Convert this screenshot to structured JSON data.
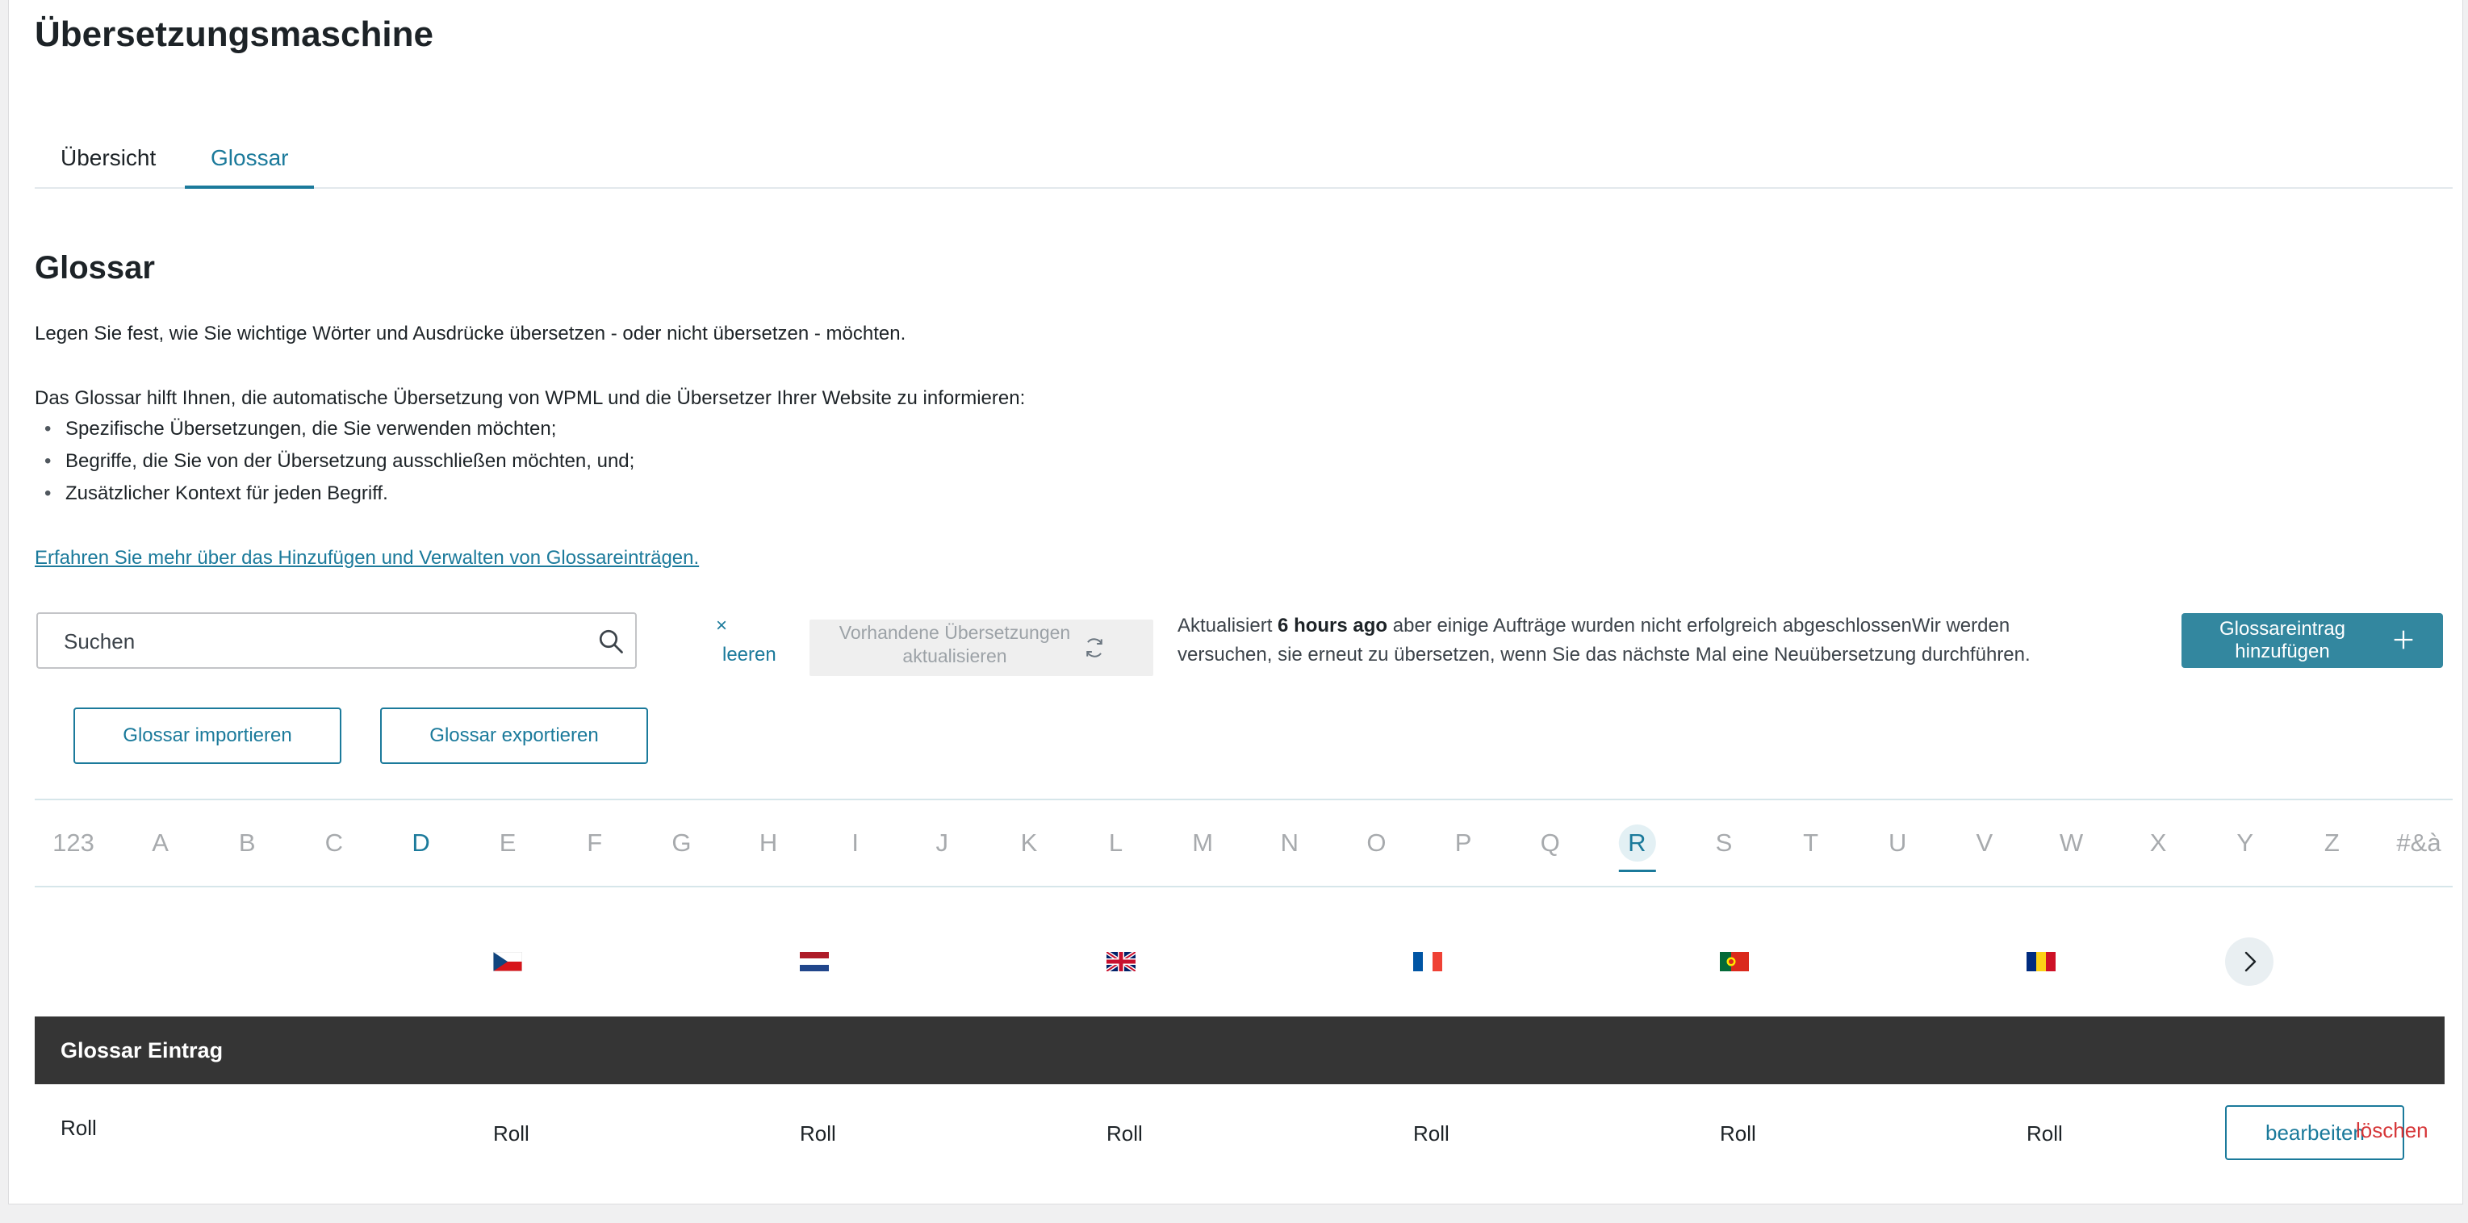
{
  "page": {
    "title": "Übersetzungsmaschine"
  },
  "tabs": [
    {
      "label": "Übersicht"
    },
    {
      "label": "Glossar"
    }
  ],
  "glossary": {
    "heading": "Glossar",
    "intro": "Legen Sie fest, wie Sie wichtige Wörter und Ausdrücke übersetzen - oder nicht übersetzen - möchten.",
    "help_intro": "Das Glossar hilft Ihnen, die automatische Übersetzung von WPML und die Übersetzer Ihrer Website zu informieren:",
    "bullets": [
      "Spezifische Übersetzungen, die Sie verwenden möchten;",
      "Begriffe, die Sie von der Übersetzung ausschließen möchten, und;",
      "Zusätzlicher Kontext für jeden Begriff."
    ],
    "learn_more": "Erfahren Sie mehr über das Hinzufügen und Verwalten von Glossareinträgen."
  },
  "toolbar": {
    "search_placeholder": "Suchen",
    "clear_x": "×",
    "clear_label": "leeren",
    "refresh_label": "Vorhandene Übersetzungen aktualisieren",
    "status_prefix": "Aktualisiert ",
    "status_time": "6 hours ago",
    "status_suffix": " aber einige Aufträge wurden nicht erfolgreich abgeschlossenWir werden versuchen, sie erneut zu übersetzen, wenn Sie das nächste Mal eine Neuübersetzung durchführen.",
    "add_label": "Glossareintrag hinzufügen",
    "import_label": "Glossar importieren",
    "export_label": "Glossar exportieren"
  },
  "alphabet": {
    "letters": [
      "123",
      "A",
      "B",
      "C",
      "D",
      "E",
      "F",
      "G",
      "H",
      "I",
      "J",
      "K",
      "L",
      "M",
      "N",
      "O",
      "P",
      "Q",
      "R",
      "S",
      "T",
      "U",
      "V",
      "W",
      "X",
      "Y",
      "Z",
      "#&à"
    ],
    "has_entries": [
      "D"
    ],
    "active": "R"
  },
  "languages": [
    {
      "code": "cs",
      "icon": "czech-flag-icon"
    },
    {
      "code": "nl",
      "icon": "dutch-flag-icon"
    },
    {
      "code": "en",
      "icon": "uk-flag-icon"
    },
    {
      "code": "fr",
      "icon": "french-flag-icon"
    },
    {
      "code": "pt",
      "icon": "portuguese-flag-icon"
    },
    {
      "code": "ro",
      "icon": "romanian-flag-icon"
    }
  ],
  "table": {
    "header": "Glossar Eintrag",
    "rows": [
      {
        "entry": "Roll",
        "translations": [
          "Roll",
          "Roll",
          "Roll",
          "Roll",
          "Roll",
          "Roll"
        ],
        "edit_label": "bearbeiten",
        "delete_label": "löschen"
      }
    ]
  },
  "colors": {
    "accent": "#1b7a9b",
    "button": "#33879f",
    "header_bg": "#353535",
    "danger": "#d63638"
  }
}
